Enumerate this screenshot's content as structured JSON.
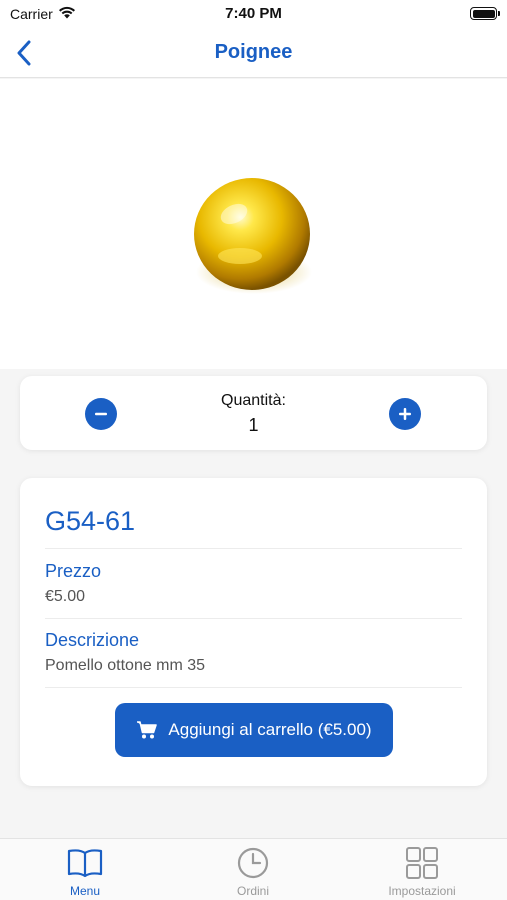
{
  "status_bar": {
    "carrier": "Carrier",
    "time": "7:40 PM"
  },
  "nav": {
    "title": "Poignee"
  },
  "quantity": {
    "label": "Quantità:",
    "value": "1"
  },
  "product": {
    "code": "G54-61",
    "price_label": "Prezzo",
    "price": "€5.00",
    "description_label": "Descrizione",
    "description": "Pomello ottone mm 35",
    "add_to_cart_label": "Aggiungi al carrello (€5.00)"
  },
  "tabs": [
    {
      "label": "Menu",
      "icon": "book-icon",
      "active": true
    },
    {
      "label": "Ordini",
      "icon": "clock-icon",
      "active": false
    },
    {
      "label": "Impostazioni",
      "icon": "grid-icon",
      "active": false
    }
  ],
  "colors": {
    "accent": "#1a5fc4",
    "inactive_tab": "#9a9a9a"
  }
}
